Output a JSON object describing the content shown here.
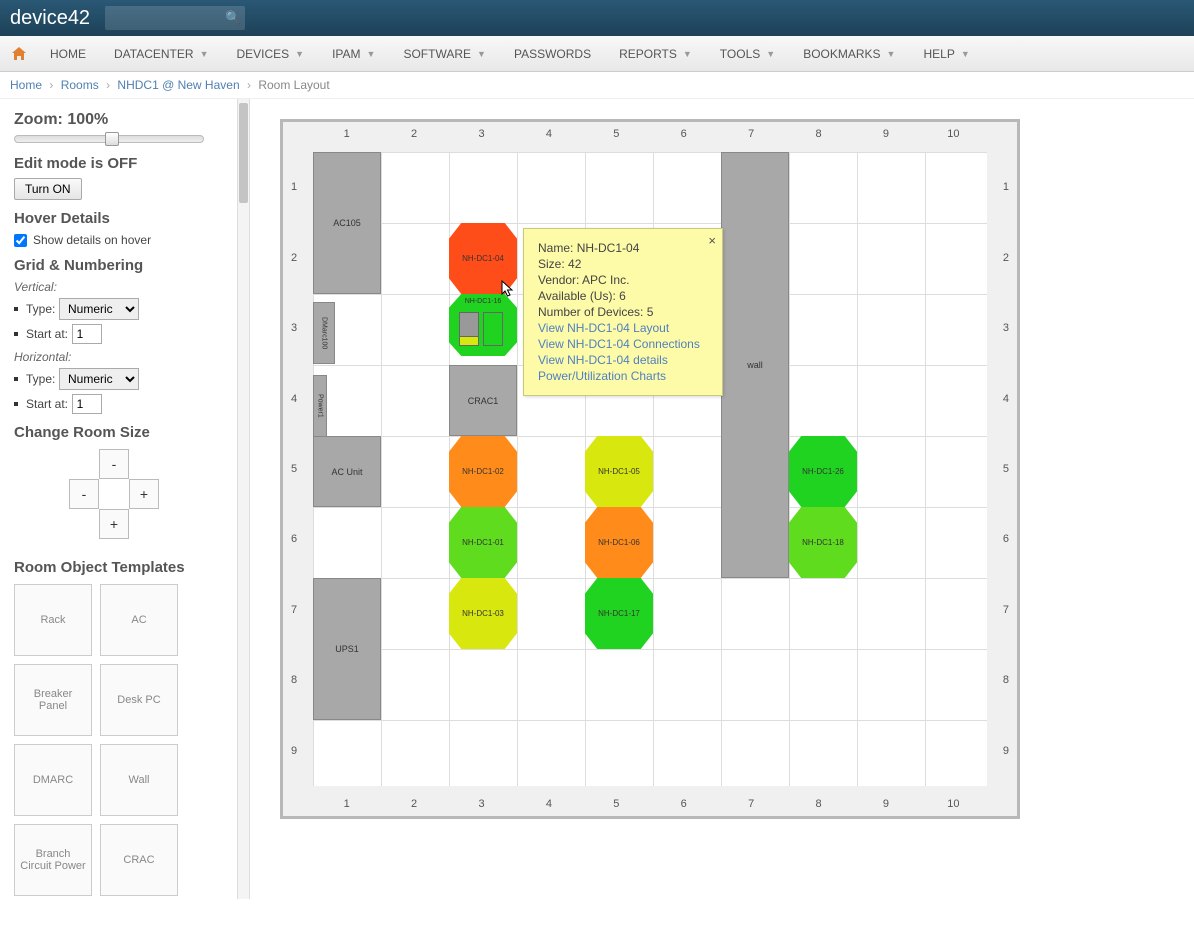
{
  "app": {
    "name": "device42"
  },
  "nav": {
    "items": [
      {
        "label": "HOME",
        "dropdown": false
      },
      {
        "label": "DATACENTER",
        "dropdown": true
      },
      {
        "label": "DEVICES",
        "dropdown": true
      },
      {
        "label": "IPAM",
        "dropdown": true
      },
      {
        "label": "SOFTWARE",
        "dropdown": true
      },
      {
        "label": "PASSWORDS",
        "dropdown": false
      },
      {
        "label": "REPORTS",
        "dropdown": true
      },
      {
        "label": "TOOLS",
        "dropdown": true
      },
      {
        "label": "BOOKMARKS",
        "dropdown": true
      },
      {
        "label": "HELP",
        "dropdown": true
      }
    ]
  },
  "breadcrumb": {
    "items": [
      "Home",
      "Rooms",
      "NHDC1 @ New Haven"
    ],
    "current": "Room Layout"
  },
  "sidebar": {
    "zoom_label": "Zoom: 100%",
    "edit_mode_label": "Edit mode is OFF",
    "turn_on": "Turn ON",
    "hover_title": "Hover Details",
    "hover_checkbox": "Show details on hover",
    "hover_checked": true,
    "grid_title": "Grid & Numbering",
    "vertical_label": "Vertical:",
    "horizontal_label": "Horizontal:",
    "type_label": "Type:",
    "type_value": "Numeric",
    "start_label": "Start at:",
    "start_value": "1",
    "change_size_title": "Change Room Size",
    "size_minus": "-",
    "size_plus": "+",
    "templates_title": "Room Object Templates",
    "templates": [
      "Rack",
      "AC",
      "Breaker Panel",
      "Desk PC",
      "DMARC",
      "Wall",
      "Branch Circuit Power",
      "CRAC"
    ]
  },
  "grid": {
    "cols": [
      "1",
      "2",
      "3",
      "4",
      "5",
      "6",
      "7",
      "8",
      "9",
      "10"
    ],
    "rows": [
      "1",
      "2",
      "3",
      "4",
      "5",
      "6",
      "7",
      "8",
      "9"
    ],
    "objects": {
      "ac105": "AC105",
      "dmarc": "DMarc100",
      "power": "Power1",
      "crac": "CRAC1",
      "acunit": "AC Unit",
      "ups": "UPS1",
      "wall": "wall",
      "r_04": "NH-DC1-04",
      "r_16": "NH-DC1-16",
      "r_02": "NH-DC1-02",
      "r_05": "NH-DC1-05",
      "r_26": "NH-DC1-26",
      "r_01": "NH-DC1-01",
      "r_06": "NH-DC1-06",
      "r_18": "NH-DC1-18",
      "r_03": "NH-DC1-03",
      "r_17": "NH-DC1-17"
    }
  },
  "tooltip": {
    "name_label": "Name: ",
    "name": "NH-DC1-04",
    "size_label": "Size: ",
    "size": "42",
    "vendor_label": "Vendor: ",
    "vendor": "APC Inc.",
    "avail_label": "Available (Us): ",
    "avail": "6",
    "devices_label": "Number of Devices: ",
    "devices": "5",
    "link_layout": "View NH-DC1-04 Layout",
    "link_conn": "View NH-DC1-04 Connections",
    "link_details": "View NH-DC1-04 details",
    "link_power": "Power/Utilization Charts",
    "close": "×"
  }
}
